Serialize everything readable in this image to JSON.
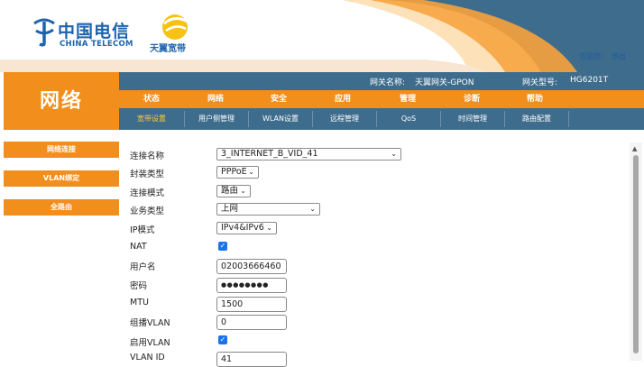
{
  "brand": {
    "telecom_cn": "中国电信",
    "telecom_en": "CHINA TELECOM",
    "broadband": "天翼宽带"
  },
  "top_links": {
    "welcome": "欢迎您!",
    "logout": "退出"
  },
  "section_title": "网络",
  "info_bar": {
    "gateway_name_label": "网关名称:",
    "gateway_name": "天翼网关-GPON",
    "gateway_model_label": "网关型号:",
    "gateway_model": "HG6201T"
  },
  "main_nav": [
    "状态",
    "网络",
    "安全",
    "应用",
    "管理",
    "诊断",
    "帮助"
  ],
  "sub_nav": [
    "宽带设置",
    "用户侧管理",
    "WLAN设置",
    "远程管理",
    "QoS",
    "时间管理",
    "路由配置"
  ],
  "side_menu": [
    "网络连接",
    "VLAN绑定",
    "全路由"
  ],
  "form": {
    "connection_name": {
      "label": "连接名称",
      "value": "3_INTERNET_B_VID_41"
    },
    "encapsulation": {
      "label": "封装类型",
      "value": "PPPoE"
    },
    "connection_mode": {
      "label": "连接模式",
      "value": "路由"
    },
    "service_type": {
      "label": "业务类型",
      "value": "上网"
    },
    "ip_mode": {
      "label": "IP模式",
      "value": "IPv4&IPv6"
    },
    "nat": {
      "label": "NAT",
      "checked": true
    },
    "username": {
      "label": "用户名",
      "value": "02003666460"
    },
    "password": {
      "label": "密码",
      "value": "●●●●●●●●"
    },
    "mtu": {
      "label": "MTU",
      "value": "1500"
    },
    "multicast_vlan": {
      "label": "组播VLAN",
      "value": "0"
    },
    "enable_vlan": {
      "label": "启用VLAN",
      "checked": true
    },
    "vlan_id": {
      "label": "VLAN ID",
      "value": "41"
    }
  },
  "colors": {
    "orange": "#f28e1c",
    "steel_blue": "#3e6c8c",
    "brand_blue": "#1e63ad",
    "check_blue": "#1a73e8"
  }
}
